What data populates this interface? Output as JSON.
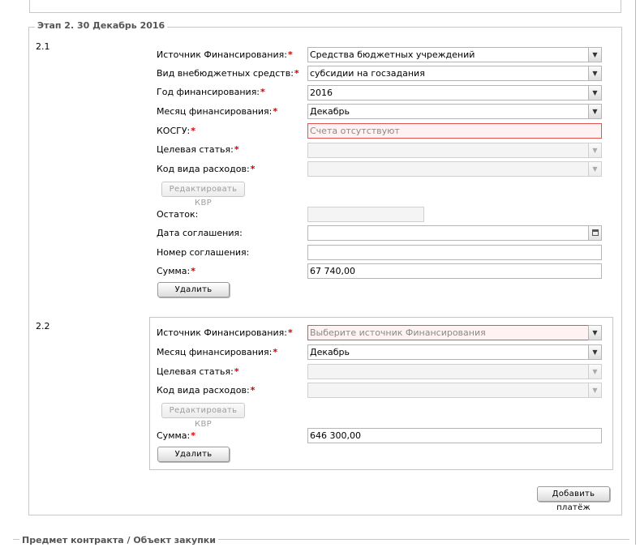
{
  "stage": {
    "legend": "Этап 2. 30 Декабрь 2016",
    "add_payment_label": "Добавить платёж",
    "groups": [
      {
        "number": "2.1",
        "source_label": "Источник Финансирования:",
        "source_value": "Средства бюджетных учреждений",
        "extrabudget_label": "Вид внебюджетных средств:",
        "extrabudget_value": "субсидии на госзадания",
        "year_label": "Год финансирования:",
        "year_value": "2016",
        "month_label": "Месяц финансирования:",
        "month_value": "Декабрь",
        "kosgu_label": "КОСГУ:",
        "kosgu_value": "Счета отсутствуют",
        "target_label": "Целевая статья:",
        "target_value": "",
        "kvr_label": "Код вида расходов:",
        "kvr_value": "",
        "edit_kvr_label": "Редактировать КВР",
        "remainder_label": "Остаток:",
        "remainder_value": "",
        "agreement_date_label": "Дата соглашения:",
        "agreement_date_value": "",
        "agreement_number_label": "Номер соглашения:",
        "agreement_number_value": "",
        "sum_label": "Сумма:",
        "sum_value": "67 740,00",
        "delete_label": "Удалить"
      },
      {
        "number": "2.2",
        "source_label": "Источник Финансирования:",
        "source_value": "Выберите источник Финансирования",
        "month_label": "Месяц финансирования:",
        "month_value": "Декабрь",
        "target_label": "Целевая статья:",
        "target_value": "",
        "kvr_label": "Код вида расходов:",
        "kvr_value": "",
        "edit_kvr_label": "Редактировать КВР",
        "sum_label": "Сумма:",
        "sum_value": "646 300,00",
        "delete_label": "Удалить"
      }
    ]
  },
  "next_section": {
    "legend": "Предмет контракта / Объект закупки"
  },
  "required_mark": "*",
  "icons": {
    "dropdown": "chevron-down-icon",
    "calendar": "calendar-icon"
  }
}
